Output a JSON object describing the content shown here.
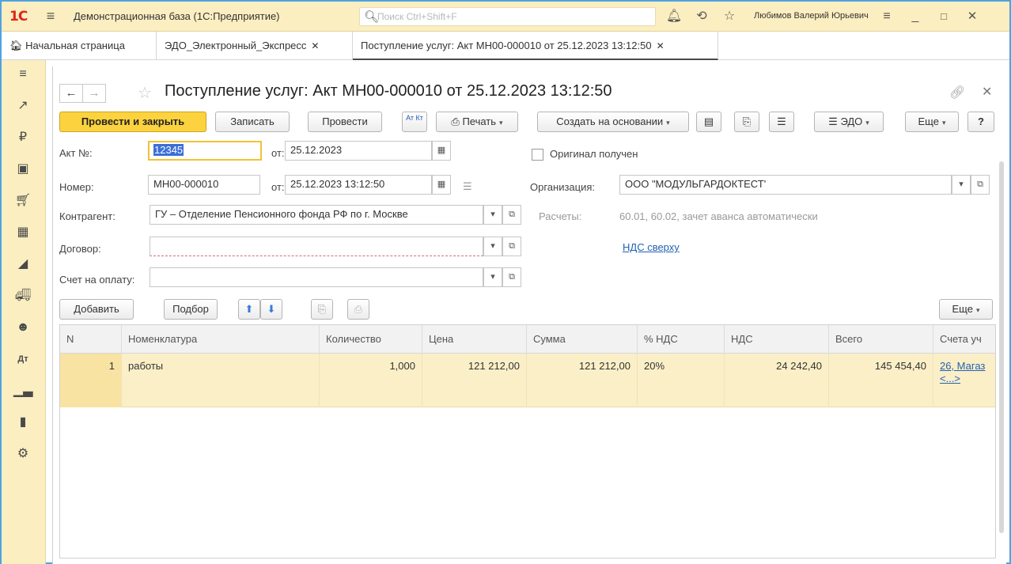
{
  "titlebar": {
    "logo": "1С",
    "app_title": "Демонстрационная база  (1С:Предприятие)",
    "search_placeholder": "Поиск Ctrl+Shift+F",
    "user_name": "Любимов Валерий Юрьевич"
  },
  "tabs": [
    {
      "label": "Начальная страница"
    },
    {
      "label": "ЭДО_Электронный_Экспресс"
    },
    {
      "label": "Поступление услуг: Акт МН00-000010 от 25.12.2023 13:12:50"
    }
  ],
  "doc": {
    "title": "Поступление услуг: Акт МН00-000010 от 25.12.2023 13:12:50"
  },
  "toolbar": {
    "post_close": "Провести и закрыть",
    "save": "Записать",
    "post": "Провести",
    "dtkt": "Ат Кт",
    "print": "Печать",
    "create_based": "Создать на основании",
    "edo": "ЭДО",
    "more": "Еще",
    "help": "?"
  },
  "form": {
    "act_no_label": "Акт №:",
    "act_no_value": "12345",
    "from_label": "от:",
    "act_date": "25.12.2023",
    "original_label": "Оригинал получен",
    "number_label": "Номер:",
    "number_value": "МН00-000010",
    "number_from_label": "от:",
    "number_date": "25.12.2023 13:12:50",
    "org_label": "Организация:",
    "org_value": "ООО \"МОДУЛЬГАРДОКТЕСТ'",
    "contractor_label": "Контрагент:",
    "contractor_value": "ГУ – Отделение Пенсионного фонда РФ по г. Москве",
    "settlements_label": "Расчеты:",
    "settlements_value": "60.01, 60.02, зачет аванса автоматически",
    "contract_label": "Договор:",
    "vat_link": "НДС сверху",
    "invoice_label": "Счет на оплату:"
  },
  "table_toolbar": {
    "add": "Добавить",
    "pick": "Подбор",
    "more": "Еще"
  },
  "table": {
    "headers": [
      "N",
      "Номенклатура",
      "Количество",
      "Цена",
      "Сумма",
      "% НДС",
      "НДС",
      "Всего",
      "Счета уч"
    ],
    "rows": [
      {
        "n": "1",
        "item": "работы",
        "qty": "1,000",
        "price": "121 212,00",
        "sum": "121 212,00",
        "vat_rate": "20%",
        "vat": "24 242,40",
        "total": "145 454,40",
        "accounts": "26, Магаз",
        "accounts_more": "<...>"
      }
    ]
  }
}
